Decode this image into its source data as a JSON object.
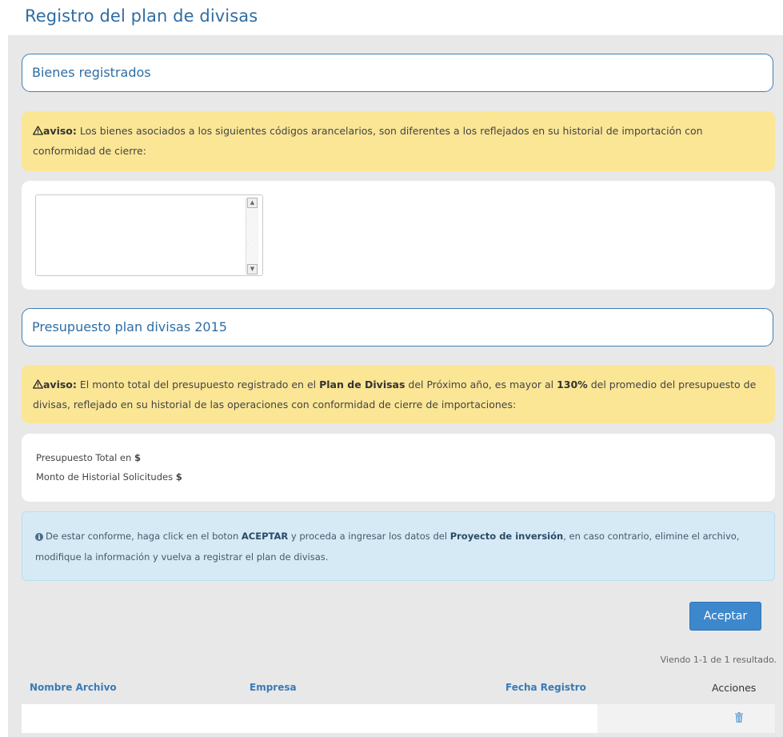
{
  "page_title": "Registro del plan de divisas",
  "sections": {
    "goods": {
      "title": "Bienes registrados"
    },
    "budget": {
      "title": "Presupuesto plan divisas 2015"
    }
  },
  "warning1": {
    "label": "aviso:",
    "text": "Los bienes asociados a los siguientes códigos arancelarios, son diferentes a los reflejados en su historial de importación con conformidad de cierre:"
  },
  "warning2": {
    "label": "aviso:",
    "text_a": "El monto total del presupuesto registrado en el",
    "bold_a": "Plan de Divisas",
    "text_b": "del Próximo año, es mayor al",
    "bold_b": "130%",
    "text_c": "del promedio del presupuesto de divisas, reflejado en su historial de las operaciones con conformidad de cierre de importaciones:"
  },
  "codes_textarea": {
    "value": ""
  },
  "budget_box": {
    "total_label": "Presupuesto Total en",
    "total_currency": "$",
    "history_label": "Monto de Historial Solicitudes",
    "history_currency": "$"
  },
  "info": {
    "text_a": "De estar conforme, haga click en el boton",
    "bold_a": "ACEPTAR",
    "text_b": "y proceda a ingresar los datos del",
    "bold_b": "Proyecto de inversión",
    "text_c": ", en caso contrario, elimine el archivo, modifique la información y vuelva a registrar el plan de divisas."
  },
  "accept_button": "Aceptar",
  "results_text": "Viendo 1-1 de 1 resultado.",
  "table": {
    "columns": [
      "Nombre Archivo",
      "Empresa",
      "Fecha Registro",
      "Acciones"
    ],
    "rows": [
      [
        "",
        "",
        "",
        "delete"
      ]
    ]
  },
  "icons": {
    "warning": "warning-triangle-icon",
    "info": "info-circle-icon",
    "delete": "trash-icon"
  },
  "colors": {
    "primary": "#2e6da4",
    "button": "#3d87cd",
    "warning_bg": "#fbe696",
    "info_bg": "#d6eaf6",
    "panel_bg": "#e8e8e8"
  }
}
